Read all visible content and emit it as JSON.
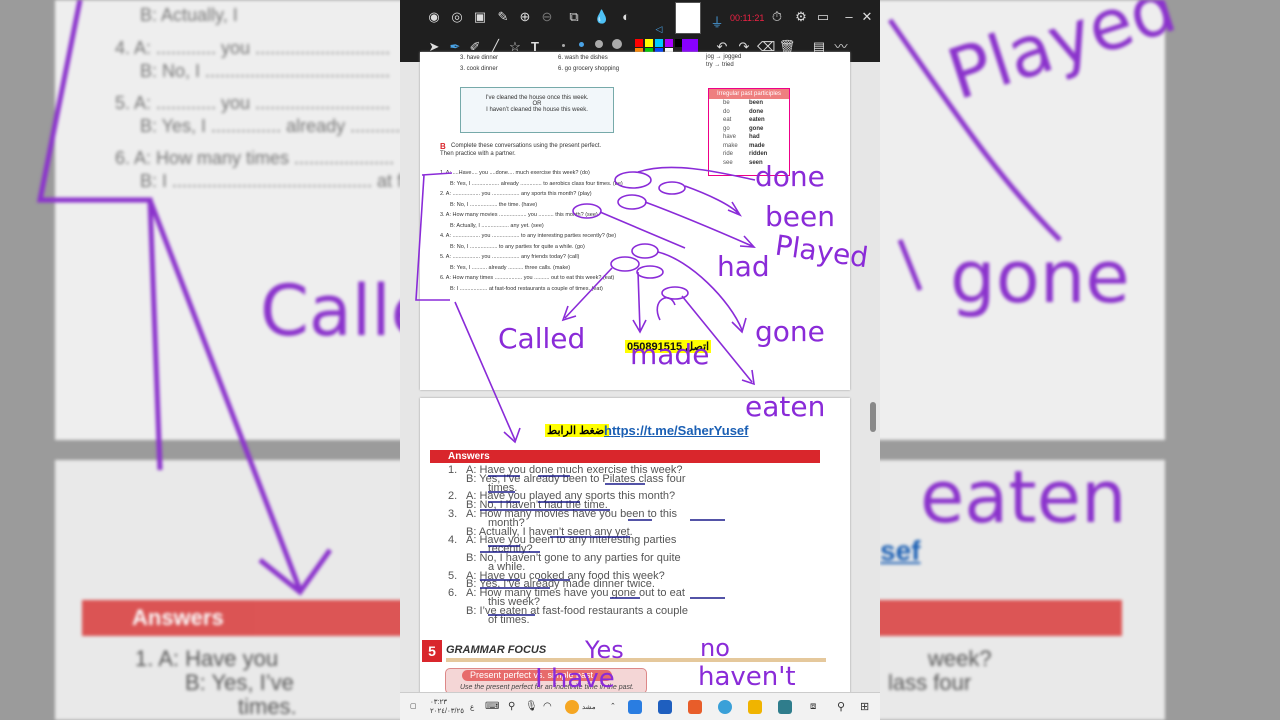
{
  "background": {
    "lines": [
      {
        "text": "B:  Actually, I"
      },
      {
        "text": "4.  A:  ............  you  ..........................."
      },
      {
        "text": "B:  No, I  ....................................."
      },
      {
        "text": "5.  A:  ............  you  ..........................."
      },
      {
        "text": "B:  Yes, I  ..............  already  ............"
      },
      {
        "text": "6.  A:  How many times  ...................."
      },
      {
        "text": "B:  I  ........................................  at fa"
      }
    ],
    "answers_label": "Answers",
    "answer_line1": "1.   A:  Have  you",
    "answer_line1_end": "week?",
    "answer_line2": "B:  Yes, I’ve",
    "answer_line2_end": "lass four",
    "answer_line3": "times.",
    "link_fragment": "sef",
    "ink_words": [
      "done",
      "been",
      "Played",
      "gone",
      "eaten",
      "Called"
    ]
  },
  "toolbar": {
    "timer": "00:11:21",
    "swatches": [
      "#ff0000",
      "#ff8800",
      "#ffff00",
      "#00cc00",
      "#00ccff",
      "#0044ff",
      "#aa00ff",
      "#ffffff",
      "#000000",
      "#8800ff"
    ],
    "pen_sizes": [
      "2",
      "5",
      "10",
      "20"
    ]
  },
  "page1": {
    "verbs_left": [
      "3.  have dinner",
      "3.  cook dinner"
    ],
    "verbs_right": [
      "6.  wash the dishes",
      "6.  go grocery shopping"
    ],
    "spelling_right": [
      "jog → jogged",
      "try → tried"
    ],
    "example_box": {
      "line1": "I’ve cleaned the house once this week.",
      "line2": "OR",
      "line3": "I haven’t cleaned the house this week."
    },
    "irregular": {
      "title": "Irregular past participles",
      "rows": [
        {
          "base": "be",
          "pp": "been"
        },
        {
          "base": "do",
          "pp": "done"
        },
        {
          "base": "eat",
          "pp": "eaten"
        },
        {
          "base": "go",
          "pp": "gone"
        },
        {
          "base": "have",
          "pp": "had"
        },
        {
          "base": "make",
          "pp": "made"
        },
        {
          "base": "ride",
          "pp": "ridden"
        },
        {
          "base": "see",
          "pp": "seen"
        }
      ]
    },
    "instructions_b": "B",
    "instructions": "Complete these conversations using the present perfect.",
    "instructions2": "Then practice with a partner.",
    "exercise": [
      "1.  A:  ....Have....  you  ....done....  much exercise this week? (do)",
      "B:  Yes, I ..................  already  ..............  to aerobics class four times. (be)",
      "2.  A:  ..................  you  ..................  any sports this month? (play)",
      "B:  No, I  ..................  the time. (have)",
      "3.  A:  How many movies  ..................  you  ..........  this month? (see)",
      "B:  Actually, I  ..................  any yet. (see)",
      "4.  A:  ..................  you  ..................  to any interesting parties recently? (be)",
      "B:  No, I  ..................  to any parties for quite a while. (go)",
      "5.  A:  ..................  you  ..................  any friends today? (call)",
      "B:  Yes, I  ..........  already  ..........  three calls. (make)",
      "6.  A:  How many times  ..................  you  ..........  out to eat this week? (eat)",
      "B:  I  ..................  at fast-food restaurants a couple of times. (eat)"
    ],
    "phone": "050891515",
    "phone_prefix": "اتصل"
  },
  "page2": {
    "tg_arabic": "اضغط الرابط",
    "tg_link": "https://t.me/SaherYusef",
    "answers_title": "Answers",
    "answers": [
      {
        "n": "1.",
        "text": "A:  Have you done much exercise this week?"
      },
      {
        "n": "",
        "text": "B:  Yes, I’ve already been to Pilates class four"
      },
      {
        "n": "",
        "text": "times."
      },
      {
        "n": "2.",
        "text": "A:  Have you played any sports this month?"
      },
      {
        "n": "",
        "text": "B:  No, I haven’t had the time."
      },
      {
        "n": "3.",
        "text": "A:  How many movies have you been to this"
      },
      {
        "n": "",
        "text": "month?"
      },
      {
        "n": "",
        "text": "B:  Actually, I haven’t seen any yet."
      },
      {
        "n": "4.",
        "text": "A:  Have you been to any interesting parties"
      },
      {
        "n": "",
        "text": "recently?"
      },
      {
        "n": "",
        "text": "B:  No, I haven’t gone to any parties for quite"
      },
      {
        "n": "",
        "text": "a while."
      },
      {
        "n": "5.",
        "text": "A:  Have you cooked any food this week?"
      },
      {
        "n": "",
        "text": "B:  Yes, I’ve already made dinner twice."
      },
      {
        "n": "6.",
        "text": "A:  How many times have you gone out to eat"
      },
      {
        "n": "",
        "text": "this week?"
      },
      {
        "n": "",
        "text": "B:  I’ve eaten at fast-food restaurants a couple"
      },
      {
        "n": "",
        "text": "of times."
      }
    ],
    "grammar_num": "5",
    "grammar_title": "GRAMMAR FOCUS",
    "present_perfect_label": "Present perfect vs. simple past",
    "use_text": "Use the present perfect for an indefinite time in the past."
  },
  "ink_words": {
    "done": "done",
    "been": "been",
    "played": "Played",
    "had": "had",
    "gone": "gone",
    "eaten": "eaten",
    "called": "Called",
    "made": "made",
    "yes": "Yes",
    "no": "no",
    "have": "I have",
    "havent": "haven't"
  },
  "taskbar": {
    "date_line1": "٠٣:٢٣",
    "date_line2": "٢٠٢٤/٠٣/٢٥",
    "lang": "ع",
    "label": "مشد"
  }
}
